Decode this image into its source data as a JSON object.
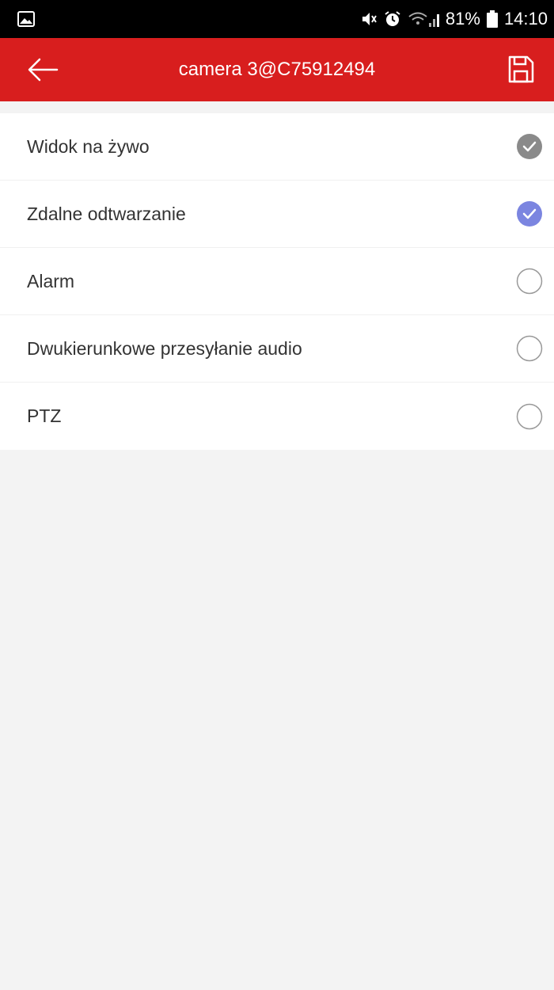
{
  "status_bar": {
    "battery": "81%",
    "time": "14:10"
  },
  "app_bar": {
    "title": "camera 3@C75912494",
    "back_icon": "arrow-left-icon",
    "save_icon": "save-floppy-icon"
  },
  "permissions": [
    {
      "label": "Widok na żywo",
      "state": "checked-disabled"
    },
    {
      "label": "Zdalne odtwarzanie",
      "state": "checked"
    },
    {
      "label": "Alarm",
      "state": "unchecked"
    },
    {
      "label": "Dwukierunkowe przesyłanie audio",
      "state": "unchecked"
    },
    {
      "label": "PTZ",
      "state": "unchecked"
    }
  ],
  "colors": {
    "accent": "#d81e1e",
    "checked": "#7b85e0",
    "checked_disabled": "#8a8a8a",
    "unchecked_border": "#999999"
  }
}
